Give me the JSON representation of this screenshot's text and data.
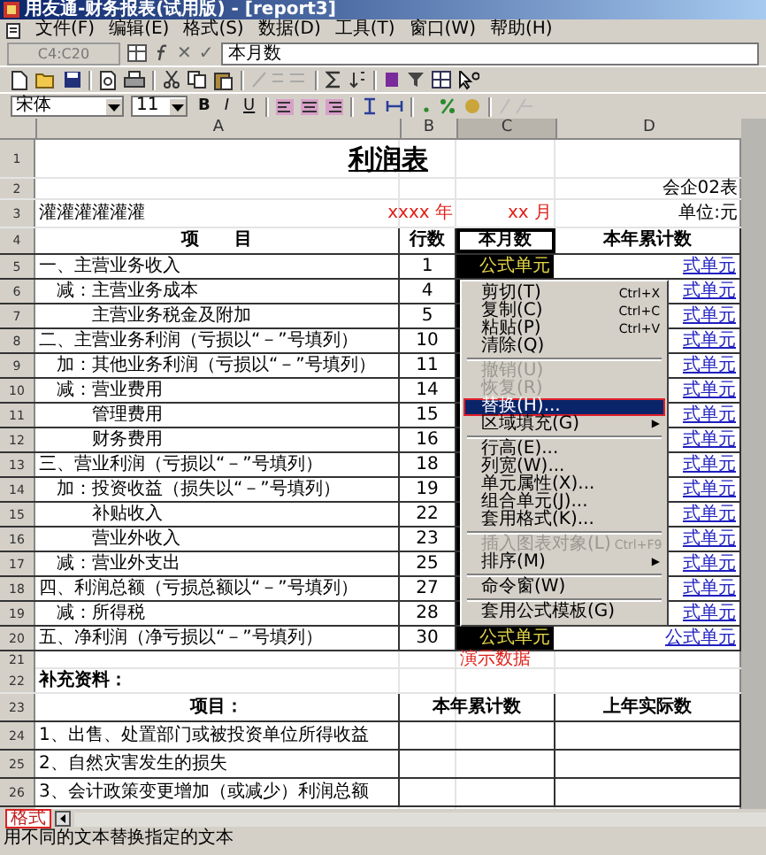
{
  "window": {
    "title": "用友通-财务报表(试用版) - [report3]"
  },
  "menu": [
    "文件(F)",
    "编辑(E)",
    "格式(S)",
    "数据(D)",
    "工具(T)",
    "窗口(W)",
    "帮助(H)"
  ],
  "formula_bar": {
    "cell": "C4:C20",
    "buttons": [
      "✕",
      "✓"
    ],
    "value": "本月数"
  },
  "format_bar": {
    "font": "宋体",
    "size": "11",
    "style_buttons": [
      "B",
      "I",
      "U"
    ]
  },
  "columns": [
    {
      "label": "A",
      "selected": false
    },
    {
      "label": "B",
      "selected": false
    },
    {
      "label": "C",
      "selected": true
    },
    {
      "label": "D",
      "selected": false
    }
  ],
  "rows": [
    {
      "n": "1",
      "kind": "title",
      "a": "利润表"
    },
    {
      "n": "2",
      "kind": "form",
      "d": "会企02表"
    },
    {
      "n": "3",
      "kind": "caption",
      "a": "灌灌灌灌灌灌",
      "b": "xxxx 年",
      "c": "xx 月",
      "d": "单位:元"
    },
    {
      "n": "4",
      "kind": "header",
      "a": "项　　目",
      "b": "行数",
      "c": "本月数",
      "d": "本年累计数",
      "active": true
    },
    {
      "n": "5",
      "kind": "item",
      "a": "一、主营业务收入",
      "b": "1",
      "c": "公式单元",
      "d": "式单元",
      "selected": true
    },
    {
      "n": "6",
      "kind": "item",
      "a": "　减：主营业务成本",
      "b": "4",
      "d": "式单元",
      "selected": true
    },
    {
      "n": "7",
      "kind": "item",
      "a": "　　　主营业务税金及附加",
      "b": "5",
      "d": "式单元",
      "selected": true
    },
    {
      "n": "8",
      "kind": "item",
      "a": "二、主营业务利润（亏损以“－”号填列）",
      "b": "10",
      "d": "式单元",
      "selected": true
    },
    {
      "n": "9",
      "kind": "item",
      "a": "　加：其他业务利润（亏损以“－”号填列）",
      "b": "11",
      "d": "式单元",
      "selected": true
    },
    {
      "n": "10",
      "kind": "item",
      "a": "　减：营业费用",
      "b": "14",
      "d": "式单元",
      "selected": true
    },
    {
      "n": "11",
      "kind": "item",
      "a": "　　　管理费用",
      "b": "15",
      "d": "式单元",
      "selected": true
    },
    {
      "n": "12",
      "kind": "item",
      "a": "　　　财务费用",
      "b": "16",
      "d": "式单元",
      "selected": true
    },
    {
      "n": "13",
      "kind": "item",
      "a": "三、营业利润（亏损以“－”号填列）",
      "b": "18",
      "d": "式单元",
      "selected": true
    },
    {
      "n": "14",
      "kind": "item",
      "a": "　加：投资收益（损失以“－”号填列）",
      "b": "19",
      "d": "式单元",
      "selected": true
    },
    {
      "n": "15",
      "kind": "item",
      "a": "　　　补贴收入",
      "b": "22",
      "d": "式单元",
      "selected": true
    },
    {
      "n": "16",
      "kind": "item",
      "a": "　　　营业外收入",
      "b": "23",
      "d": "式单元",
      "selected": true
    },
    {
      "n": "17",
      "kind": "item",
      "a": "　减：营业外支出",
      "b": "25",
      "d": "式单元",
      "selected": true
    },
    {
      "n": "18",
      "kind": "item",
      "a": "四、利润总额（亏损总额以“－”号填列）",
      "b": "27",
      "d": "式单元",
      "selected": true
    },
    {
      "n": "19",
      "kind": "item",
      "a": "　减：所得税",
      "b": "28",
      "d": "式单元",
      "selected": true
    },
    {
      "n": "20",
      "kind": "item",
      "a": "五、净利润（净亏损以“－”号填列）",
      "b": "30",
      "c": "公式单元",
      "d": "公式单元",
      "selected": true
    },
    {
      "n": "21",
      "kind": "demo",
      "c": "演示数据"
    },
    {
      "n": "22",
      "kind": "section",
      "a": "补充资料："
    },
    {
      "n": "23",
      "kind": "header2",
      "a": "项目：",
      "b": "本年累计数",
      "d": "上年实际数"
    },
    {
      "n": "24",
      "kind": "item2",
      "a": "1、出售、处置部门或被投资单位所得收益"
    },
    {
      "n": "25",
      "kind": "item2",
      "a": "2、自然灾害发生的损失"
    },
    {
      "n": "26",
      "kind": "item2",
      "a": "3、会计政策变更增加（或减少）利润总额"
    }
  ],
  "context_menu": {
    "items": [
      {
        "kind": "item",
        "label": "剪切(T)",
        "shortcut": "Ctrl+X",
        "disabled": false,
        "selected": false
      },
      {
        "kind": "item",
        "label": "复制(C)",
        "shortcut": "Ctrl+C",
        "disabled": false,
        "selected": false
      },
      {
        "kind": "item",
        "label": "粘贴(P)",
        "shortcut": "Ctrl+V",
        "disabled": false,
        "selected": false
      },
      {
        "kind": "item",
        "label": "清除(Q)",
        "disabled": false,
        "selected": false
      },
      {
        "kind": "separator"
      },
      {
        "kind": "item",
        "label": "撤销(U)",
        "disabled": true,
        "selected": false
      },
      {
        "kind": "item",
        "label": "恢复(R)",
        "disabled": true,
        "selected": false
      },
      {
        "kind": "item",
        "label": "替换(H)...",
        "disabled": false,
        "selected": true
      },
      {
        "kind": "item",
        "label": "区域填充(G)",
        "arrow": "▶",
        "disabled": false,
        "selected": false
      },
      {
        "kind": "separator"
      },
      {
        "kind": "item",
        "label": "行高(E)...",
        "disabled": false,
        "selected": false
      },
      {
        "kind": "item",
        "label": "列宽(W)...",
        "disabled": false,
        "selected": false
      },
      {
        "kind": "item",
        "label": "单元属性(X)...",
        "disabled": false,
        "selected": false
      },
      {
        "kind": "item",
        "label": "组合单元(J)...",
        "disabled": false,
        "selected": false
      },
      {
        "kind": "item",
        "label": "套用格式(K)...",
        "disabled": false,
        "selected": false
      },
      {
        "kind": "separator"
      },
      {
        "kind": "item",
        "label": "插入图表对象(L)",
        "shortcut": "Ctrl+F9",
        "disabled": true,
        "selected": false
      },
      {
        "kind": "item",
        "label": "排序(M)",
        "arrow": "▶",
        "disabled": false,
        "selected": false
      },
      {
        "kind": "separator"
      },
      {
        "kind": "item",
        "label": "命令窗(W)",
        "disabled": false,
        "selected": false
      },
      {
        "kind": "separator"
      },
      {
        "kind": "item",
        "label": "套用公式模板(G)",
        "disabled": false,
        "selected": false
      }
    ]
  },
  "sheet_tab": {
    "label": "格式"
  },
  "status_bar": "用不同的文本替换指定的文本"
}
